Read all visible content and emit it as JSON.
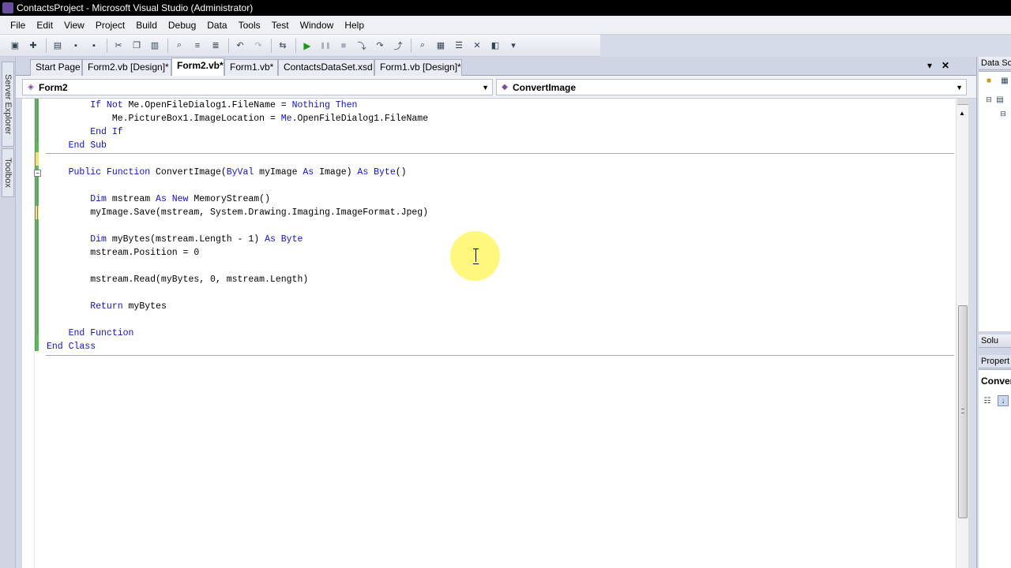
{
  "window": {
    "title": "ContactsProject - Microsoft Visual Studio (Administrator)"
  },
  "menu": [
    "File",
    "Edit",
    "View",
    "Project",
    "Build",
    "Debug",
    "Data",
    "Tools",
    "Test",
    "Window",
    "Help"
  ],
  "toolbar": {
    "icons": [
      "new-project-icon",
      "add-item-icon",
      "open-file-icon",
      "save-icon",
      "save-all-icon",
      "cut-icon",
      "copy-icon",
      "paste-icon",
      "find-icon",
      "comment-icon",
      "uncomment-icon",
      "undo-icon",
      "redo-icon",
      "navigate-icon",
      "start-debugging-icon",
      "break-all-icon",
      "stop-icon",
      "step-into-icon",
      "step-over-icon",
      "step-out-icon",
      "find-in-files-icon",
      "solution-explorer-icon",
      "properties-icon",
      "toolbox-icon",
      "object-browser-icon",
      "more-icon"
    ]
  },
  "side_tabs": {
    "server_explorer": "Server Explorer",
    "toolbox": "Toolbox"
  },
  "tabs": [
    {
      "label": "Start Page",
      "active": false
    },
    {
      "label": "Form2.vb [Design]*",
      "active": false
    },
    {
      "label": "Form2.vb*",
      "active": true
    },
    {
      "label": "Form1.vb*",
      "active": false
    },
    {
      "label": "ContactsDataSet.xsd",
      "active": false
    },
    {
      "label": "Form1.vb [Design]*",
      "active": false
    }
  ],
  "navbar": {
    "class_combo": "Form2",
    "method_combo": "ConvertImage"
  },
  "code": [
    {
      "indent": "        ",
      "tokens": [
        [
          "kw",
          "If Not "
        ],
        [
          "",
          "Me"
        ],
        [
          "",
          ".OpenFileDialog1.FileName = "
        ],
        [
          "kw",
          "Nothing Then"
        ]
      ]
    },
    {
      "indent": "            ",
      "tokens": [
        [
          "",
          "Me.PictureBox1.ImageLocation = "
        ],
        [
          "kw",
          "Me"
        ],
        [
          "",
          ".OpenFileDialog1.FileName"
        ]
      ]
    },
    {
      "indent": "        ",
      "tokens": [
        [
          "kw",
          "End If"
        ]
      ]
    },
    {
      "indent": "    ",
      "tokens": [
        [
          "kw",
          "End Sub"
        ]
      ]
    },
    {
      "indent": "",
      "tokens": []
    },
    {
      "indent": "    ",
      "tokens": [
        [
          "kw",
          "Public Function "
        ],
        [
          "",
          "ConvertImage("
        ],
        [
          "kw",
          "ByVal "
        ],
        [
          "",
          "myImage "
        ],
        [
          "kw",
          "As "
        ],
        [
          "",
          "Image) "
        ],
        [
          "kw",
          "As Byte"
        ],
        [
          "",
          "()"
        ]
      ]
    },
    {
      "indent": "",
      "tokens": []
    },
    {
      "indent": "        ",
      "tokens": [
        [
          "kw",
          "Dim "
        ],
        [
          "",
          "mstream "
        ],
        [
          "kw",
          "As New "
        ],
        [
          "",
          "MemoryStream()"
        ]
      ]
    },
    {
      "indent": "        ",
      "tokens": [
        [
          "",
          "myImage.Save(mstream, System.Drawing.Imaging.ImageFormat.Jpeg)"
        ]
      ]
    },
    {
      "indent": "",
      "tokens": []
    },
    {
      "indent": "        ",
      "tokens": [
        [
          "kw",
          "Dim "
        ],
        [
          "",
          "myBytes(mstream.Length - 1) "
        ],
        [
          "kw",
          "As Byte"
        ]
      ]
    },
    {
      "indent": "        ",
      "tokens": [
        [
          "",
          "mstream.Position = 0"
        ]
      ]
    },
    {
      "indent": "",
      "tokens": []
    },
    {
      "indent": "        ",
      "tokens": [
        [
          "",
          "mstream.Read(myBytes, 0, mstream.Length)"
        ]
      ]
    },
    {
      "indent": "",
      "tokens": []
    },
    {
      "indent": "        ",
      "tokens": [
        [
          "kw",
          "Return "
        ],
        [
          "",
          "myBytes"
        ]
      ]
    },
    {
      "indent": "",
      "tokens": []
    },
    {
      "indent": "    ",
      "tokens": [
        [
          "kw",
          "End Function"
        ]
      ]
    },
    {
      "indent": "",
      "tokens": [
        [
          "kw",
          "End Class"
        ]
      ]
    }
  ],
  "right_panel": {
    "data_sources": "Data So",
    "solution": "Solu",
    "properties": "Propert",
    "properties_object": "Conver"
  },
  "colors": {
    "keyword": "#1010d0",
    "changebar_saved": "#4fc24f",
    "changebar_unsaved": "#f5e26b",
    "cursor_highlight": "#fff550"
  }
}
